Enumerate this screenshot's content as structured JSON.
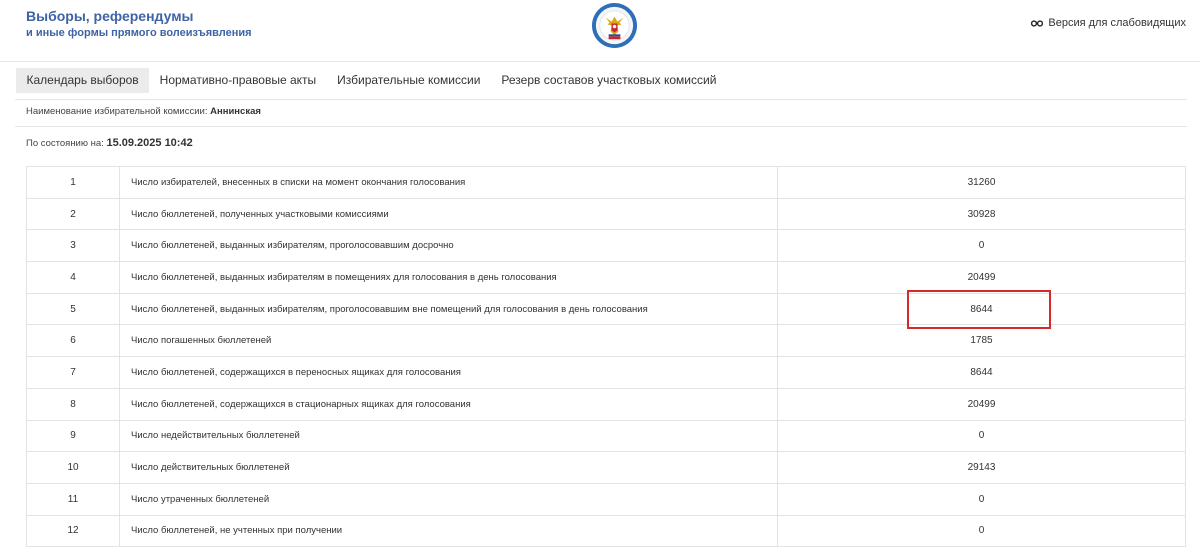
{
  "header": {
    "title": "Выборы, референдумы",
    "subtitle": "и иные формы прямого волеизъявления",
    "accessibility_label": "Версия для слабовидящих"
  },
  "nav": {
    "items": [
      "Календарь выборов",
      "Нормативно-правовые акты",
      "Избирательные комиссии",
      "Резерв составов участковых комиссий"
    ]
  },
  "commission": {
    "label": "Наименование избирательной комиссии:",
    "name": "Аннинская"
  },
  "status": {
    "label": "По состоянию на:",
    "datetime": "15.09.2025 10:42"
  },
  "table": {
    "rows": [
      {
        "num": "1",
        "label": "Число избирателей, внесенных в списки на момент окончания голосования",
        "value": "31260"
      },
      {
        "num": "2",
        "label": "Число бюллетеней, полученных участковыми комиссиями",
        "value": "30928"
      },
      {
        "num": "3",
        "label": "Число бюллетеней, выданных избирателям, проголосовавшим досрочно",
        "value": "0"
      },
      {
        "num": "4",
        "label": "Число бюллетеней, выданных избирателям в помещениях для голосования в день голосования",
        "value": "20499"
      },
      {
        "num": "5",
        "label": "Число бюллетеней, выданных избирателям, проголосовавшим вне помещений для голосования в день голосования",
        "value": "8644"
      },
      {
        "num": "6",
        "label": "Число погашенных бюллетеней",
        "value": "1785"
      },
      {
        "num": "7",
        "label": "Число бюллетеней, содержащихся в переносных ящиках для голосования",
        "value": "8644"
      },
      {
        "num": "8",
        "label": "Число бюллетеней, содержащихся в стационарных ящиках для голосования",
        "value": "20499"
      },
      {
        "num": "9",
        "label": "Число недействительных бюллетеней",
        "value": "0"
      },
      {
        "num": "10",
        "label": "Число действительных бюллетеней",
        "value": "29143"
      },
      {
        "num": "11",
        "label": "Число утраченных бюллетеней",
        "value": "0"
      },
      {
        "num": "12",
        "label": "Число бюллетеней, не учтенных при получении",
        "value": "0"
      }
    ]
  },
  "colors": {
    "brand": "#3f64a5",
    "highlight": "#d62a2a"
  },
  "icons": {
    "emblem": "election-commission-emblem-icon",
    "accessibility": "glasses-icon"
  }
}
